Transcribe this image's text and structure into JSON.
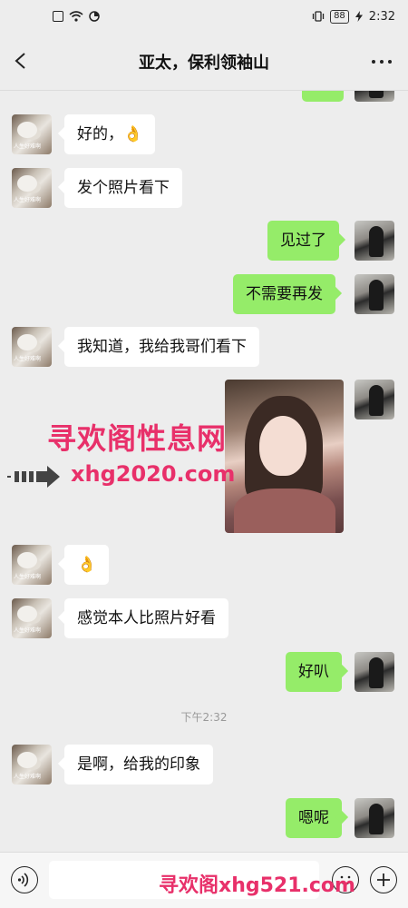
{
  "status_bar": {
    "time": "2:32",
    "battery": "88"
  },
  "nav": {
    "title": "亚太，保利领袖山"
  },
  "avatar_left_tag": "人生好难啊",
  "messages": [
    {
      "side": "left",
      "text": "好的，",
      "emoji": "👌"
    },
    {
      "side": "left",
      "text": "发个照片看下"
    },
    {
      "side": "right",
      "text": "见过了"
    },
    {
      "side": "right",
      "text": "不需要再发"
    },
    {
      "side": "left",
      "text": "我知道，我给我哥们看下"
    },
    {
      "side": "right",
      "type": "image"
    },
    {
      "side": "left",
      "emoji": "👌"
    },
    {
      "side": "left",
      "text": "感觉本人比照片好看"
    },
    {
      "side": "right",
      "text": "好叭"
    },
    {
      "side": "left",
      "text": "是啊，给我的印象"
    },
    {
      "side": "right",
      "text": "嗯呢"
    }
  ],
  "time_divider": "下午2:32",
  "watermark": {
    "line1": "寻欢阁性息网",
    "line2": "xhg2020.com",
    "footer": "寻欢阁xhg521.com"
  },
  "input": {
    "placeholder": ""
  }
}
